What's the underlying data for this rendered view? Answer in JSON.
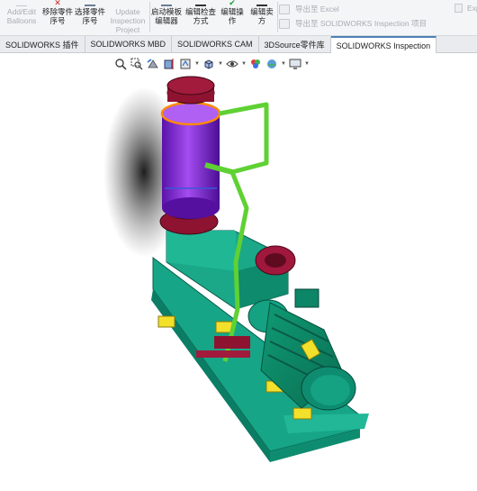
{
  "ribbon": {
    "add_edit_balloons": "Add/Edit Balloons",
    "remove_part_number": "移除零件序号",
    "select_part_number": "选择零件序号",
    "update_inspection_project": "Update Inspection Project",
    "launch_template_editor": "启动模板编辑器",
    "edit_inspection_method": "编辑检查方式",
    "edit_operation": "编辑操作",
    "edit_vendor": "编辑卖方",
    "export_excel": "导出至 Excel",
    "export_inspection_project": "导出至 SOLIDWORKS Inspection 项目",
    "export_short": "Expo"
  },
  "tabs": [
    {
      "label": "SOLIDWORKS 插件"
    },
    {
      "label": "SOLIDWORKS MBD"
    },
    {
      "label": "SOLIDWORKS CAM"
    },
    {
      "label": "3DSource零件库"
    },
    {
      "label": "SOLIDWORKS Inspection"
    }
  ],
  "hud_icons": [
    "zoom-to-fit-icon",
    "zoom-to-area-icon",
    "previous-view-icon",
    "section-view-icon",
    "dynamic-annotation-icon",
    "view-orientation-icon",
    "display-style-icon",
    "hide-show-items-icon",
    "edit-appearance-icon",
    "apply-scene-icon",
    "view-settings-icon"
  ],
  "colors": {
    "ribbon_bg": "#f4f5f7",
    "tab_active_accent": "#4f7fb8",
    "base_teal": "#1fa98a",
    "tank_purple": "#8a2ad6",
    "flange_maroon": "#8e1330",
    "pipe_green": "#5fd133",
    "support_yellow": "#f2e02a"
  }
}
